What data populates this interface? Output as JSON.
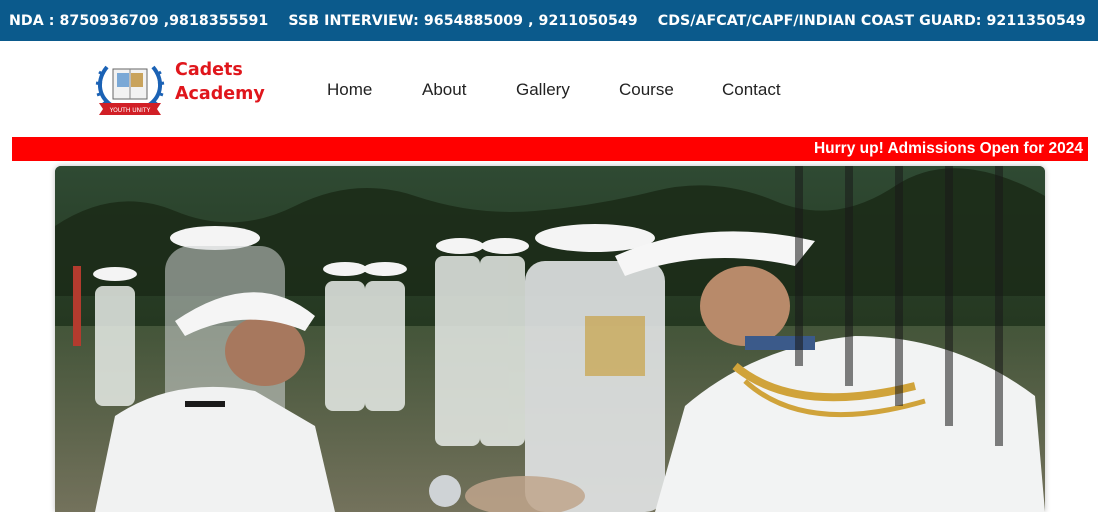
{
  "topbar": {
    "nda": "NDA : 8750936709 ,9818355591",
    "ssb": "SSB INTERVIEW: 9654885009 , 9211050549",
    "cds": "CDS/AFCAT/CAPF/INDIAN COAST GUARD: 9211350549"
  },
  "brand": {
    "line1": "Cadets",
    "line2": "Academy",
    "badge_text": "YOUTH UNITY",
    "color": "#e0161c"
  },
  "nav": {
    "items": [
      "Home",
      "About",
      "Gallery",
      "Course",
      "Contact"
    ]
  },
  "ticker": {
    "text": "Hurry up! Admissions Open for 2024"
  },
  "colors": {
    "topbar": "#0b5a8c",
    "ticker": "#ff0000",
    "text": "#222222"
  },
  "hero": {
    "image": "naval-officers-handshake-photo"
  }
}
